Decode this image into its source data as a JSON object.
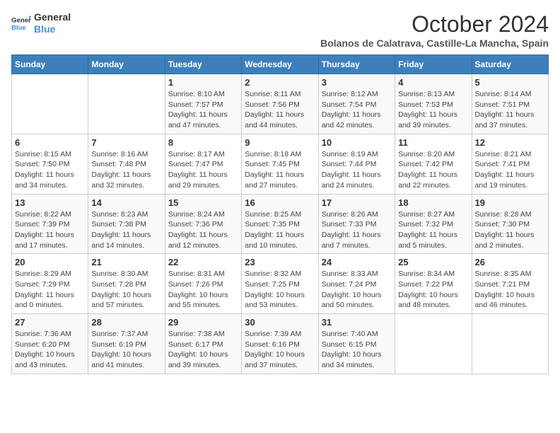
{
  "header": {
    "logo_line1": "General",
    "logo_line2": "Blue",
    "month": "October 2024",
    "location": "Bolanos de Calatrava, Castille-La Mancha, Spain"
  },
  "weekdays": [
    "Sunday",
    "Monday",
    "Tuesday",
    "Wednesday",
    "Thursday",
    "Friday",
    "Saturday"
  ],
  "weeks": [
    [
      {
        "day": "",
        "detail": ""
      },
      {
        "day": "",
        "detail": ""
      },
      {
        "day": "1",
        "detail": "Sunrise: 8:10 AM\nSunset: 7:57 PM\nDaylight: 11 hours and 47 minutes."
      },
      {
        "day": "2",
        "detail": "Sunrise: 8:11 AM\nSunset: 7:56 PM\nDaylight: 11 hours and 44 minutes."
      },
      {
        "day": "3",
        "detail": "Sunrise: 8:12 AM\nSunset: 7:54 PM\nDaylight: 11 hours and 42 minutes."
      },
      {
        "day": "4",
        "detail": "Sunrise: 8:13 AM\nSunset: 7:53 PM\nDaylight: 11 hours and 39 minutes."
      },
      {
        "day": "5",
        "detail": "Sunrise: 8:14 AM\nSunset: 7:51 PM\nDaylight: 11 hours and 37 minutes."
      }
    ],
    [
      {
        "day": "6",
        "detail": "Sunrise: 8:15 AM\nSunset: 7:50 PM\nDaylight: 11 hours and 34 minutes."
      },
      {
        "day": "7",
        "detail": "Sunrise: 8:16 AM\nSunset: 7:48 PM\nDaylight: 11 hours and 32 minutes."
      },
      {
        "day": "8",
        "detail": "Sunrise: 8:17 AM\nSunset: 7:47 PM\nDaylight: 11 hours and 29 minutes."
      },
      {
        "day": "9",
        "detail": "Sunrise: 8:18 AM\nSunset: 7:45 PM\nDaylight: 11 hours and 27 minutes."
      },
      {
        "day": "10",
        "detail": "Sunrise: 8:19 AM\nSunset: 7:44 PM\nDaylight: 11 hours and 24 minutes."
      },
      {
        "day": "11",
        "detail": "Sunrise: 8:20 AM\nSunset: 7:42 PM\nDaylight: 11 hours and 22 minutes."
      },
      {
        "day": "12",
        "detail": "Sunrise: 8:21 AM\nSunset: 7:41 PM\nDaylight: 11 hours and 19 minutes."
      }
    ],
    [
      {
        "day": "13",
        "detail": "Sunrise: 8:22 AM\nSunset: 7:39 PM\nDaylight: 11 hours and 17 minutes."
      },
      {
        "day": "14",
        "detail": "Sunrise: 8:23 AM\nSunset: 7:38 PM\nDaylight: 11 hours and 14 minutes."
      },
      {
        "day": "15",
        "detail": "Sunrise: 8:24 AM\nSunset: 7:36 PM\nDaylight: 11 hours and 12 minutes."
      },
      {
        "day": "16",
        "detail": "Sunrise: 8:25 AM\nSunset: 7:35 PM\nDaylight: 11 hours and 10 minutes."
      },
      {
        "day": "17",
        "detail": "Sunrise: 8:26 AM\nSunset: 7:33 PM\nDaylight: 11 hours and 7 minutes."
      },
      {
        "day": "18",
        "detail": "Sunrise: 8:27 AM\nSunset: 7:32 PM\nDaylight: 11 hours and 5 minutes."
      },
      {
        "day": "19",
        "detail": "Sunrise: 8:28 AM\nSunset: 7:30 PM\nDaylight: 11 hours and 2 minutes."
      }
    ],
    [
      {
        "day": "20",
        "detail": "Sunrise: 8:29 AM\nSunset: 7:29 PM\nDaylight: 11 hours and 0 minutes."
      },
      {
        "day": "21",
        "detail": "Sunrise: 8:30 AM\nSunset: 7:28 PM\nDaylight: 10 hours and 57 minutes."
      },
      {
        "day": "22",
        "detail": "Sunrise: 8:31 AM\nSunset: 7:26 PM\nDaylight: 10 hours and 55 minutes."
      },
      {
        "day": "23",
        "detail": "Sunrise: 8:32 AM\nSunset: 7:25 PM\nDaylight: 10 hours and 53 minutes."
      },
      {
        "day": "24",
        "detail": "Sunrise: 8:33 AM\nSunset: 7:24 PM\nDaylight: 10 hours and 50 minutes."
      },
      {
        "day": "25",
        "detail": "Sunrise: 8:34 AM\nSunset: 7:22 PM\nDaylight: 10 hours and 48 minutes."
      },
      {
        "day": "26",
        "detail": "Sunrise: 8:35 AM\nSunset: 7:21 PM\nDaylight: 10 hours and 46 minutes."
      }
    ],
    [
      {
        "day": "27",
        "detail": "Sunrise: 7:36 AM\nSunset: 6:20 PM\nDaylight: 10 hours and 43 minutes."
      },
      {
        "day": "28",
        "detail": "Sunrise: 7:37 AM\nSunset: 6:19 PM\nDaylight: 10 hours and 41 minutes."
      },
      {
        "day": "29",
        "detail": "Sunrise: 7:38 AM\nSunset: 6:17 PM\nDaylight: 10 hours and 39 minutes."
      },
      {
        "day": "30",
        "detail": "Sunrise: 7:39 AM\nSunset: 6:16 PM\nDaylight: 10 hours and 37 minutes."
      },
      {
        "day": "31",
        "detail": "Sunrise: 7:40 AM\nSunset: 6:15 PM\nDaylight: 10 hours and 34 minutes."
      },
      {
        "day": "",
        "detail": ""
      },
      {
        "day": "",
        "detail": ""
      }
    ]
  ]
}
